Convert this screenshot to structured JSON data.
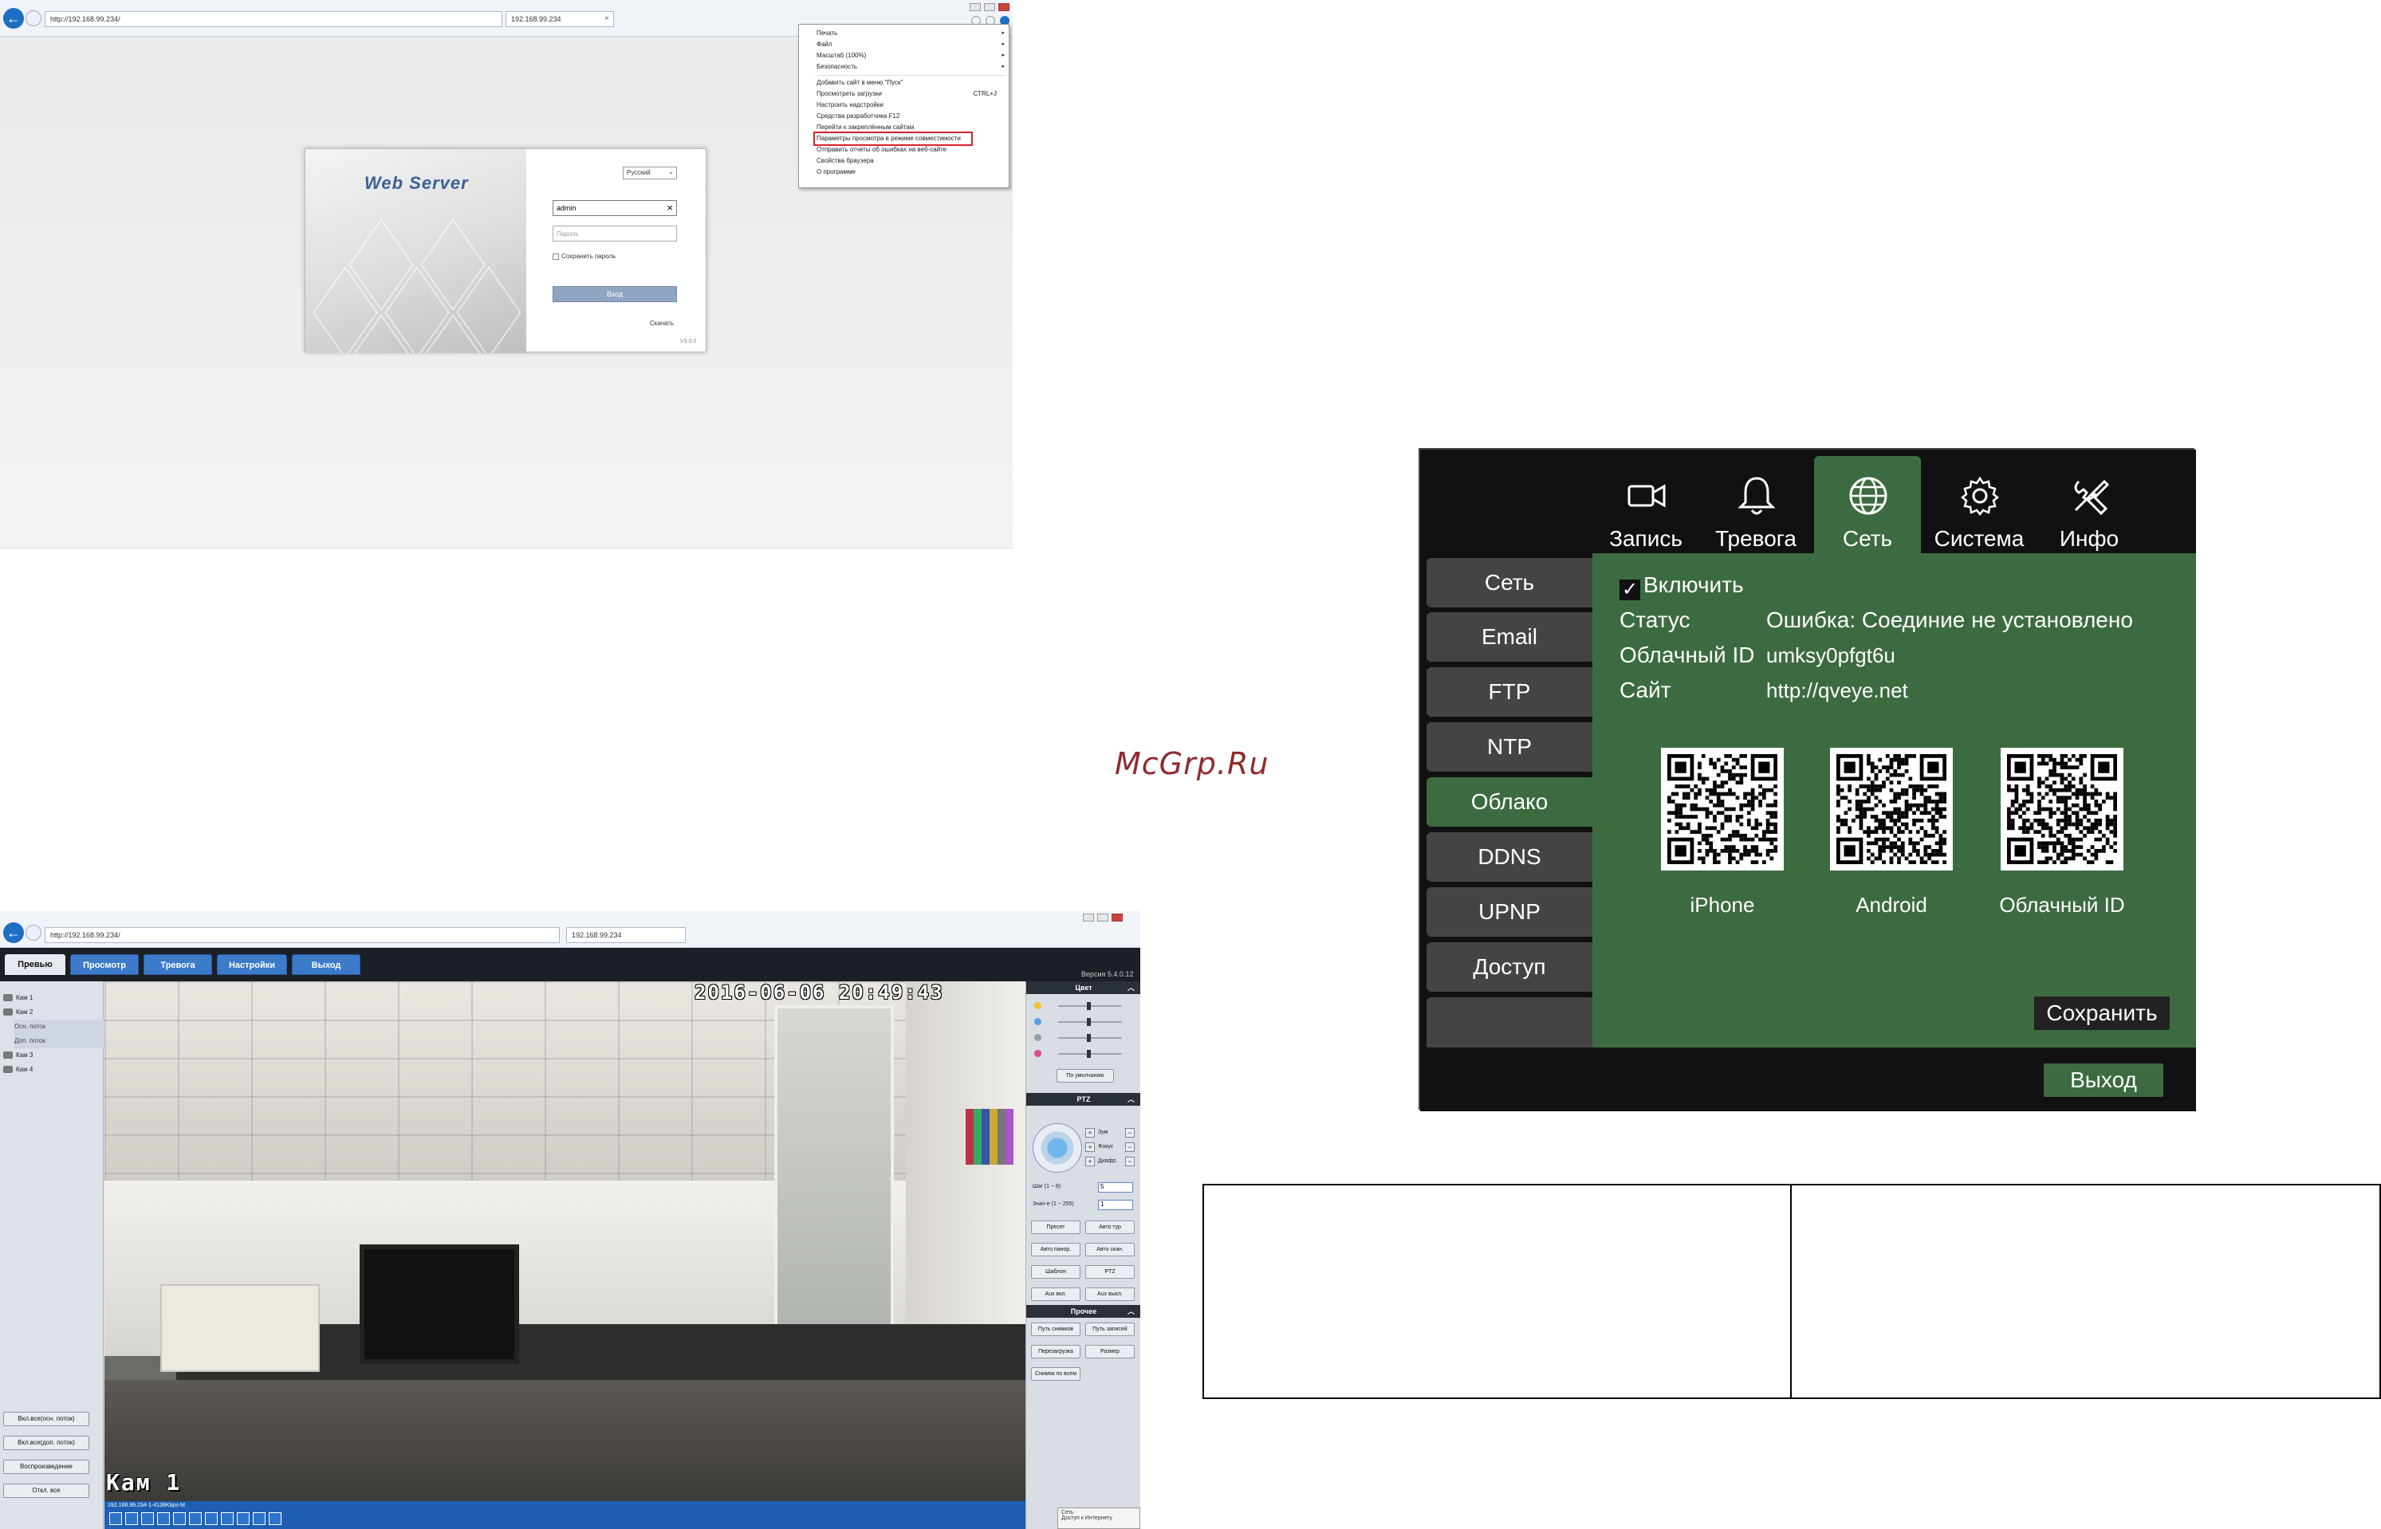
{
  "browser1": {
    "url": "http://192.168.99.234/",
    "tab": "192.168.99.234",
    "menu": [
      {
        "label": "Печать",
        "arrow": "▸"
      },
      {
        "label": "Файл",
        "arrow": "▸"
      },
      {
        "label": "Масштаб (100%)",
        "arrow": "▸"
      },
      {
        "label": "Безопасность",
        "arrow": "▸"
      },
      {
        "label": "Добавить сайт в меню \"Пуск\"",
        "arrow": ""
      },
      {
        "label": "Просмотреть загрузки",
        "shortcut": "CTRL+J"
      },
      {
        "label": "Настроить надстройки",
        "arrow": ""
      },
      {
        "label": "Средства разработчика F12",
        "arrow": ""
      },
      {
        "label": "Перейти к закреплённым сайтам",
        "arrow": ""
      },
      {
        "label": "Параметры просмотра в режиме совместимости",
        "arrow": ""
      },
      {
        "label": "Отправить отчеты об ошибках на веб-сайте",
        "arrow": ""
      },
      {
        "label": "Свойства браузера",
        "arrow": ""
      },
      {
        "label": "О программе",
        "arrow": ""
      }
    ]
  },
  "login": {
    "title": "Web Server",
    "language": "Русский",
    "username": "admin",
    "password_placeholder": "Пароль",
    "remember": "Сохранить пароль",
    "login_button": "Вход",
    "download": "Скачать",
    "version": "V3.0.0"
  },
  "browser2": {
    "url": "http://192.168.99.234/",
    "tab": "192.168.99.234"
  },
  "liveview": {
    "nav": [
      "Превью",
      "Просмотр",
      "Тревога",
      "Настройки",
      "Выход"
    ],
    "version": "Версия 5.4.0.12",
    "cameras": [
      {
        "label": "Кам 1",
        "sub": false,
        "selected": false
      },
      {
        "label": "Кам 2",
        "sub": false,
        "selected": false
      },
      {
        "label": "Осн. поток",
        "sub": true,
        "selected": true
      },
      {
        "label": "Доп. поток",
        "sub": true,
        "selected": true
      },
      {
        "label": "Кам 3",
        "sub": false,
        "selected": false
      },
      {
        "label": "Кам 4",
        "sub": false,
        "selected": false
      }
    ],
    "side_buttons": [
      "Вкл.все(осн. поток)",
      "Вкл.все(доп. поток)",
      "Воспроизведение",
      "Откл. все"
    ],
    "osd_time": "2016-06-06 20:49:43",
    "osd_cam": "Кам 1",
    "status_text": "192.168.99.234-1-4138Kbps-M",
    "color_panel": {
      "header": "Цвет",
      "dots": [
        "#f0c030",
        "#5aa0e0",
        "#9aa0a8",
        "#d84c8c"
      ],
      "default_btn": "По умолчанию"
    },
    "ptz_panel": {
      "header": "PTZ",
      "labels": [
        "Зум",
        "Фокус",
        "Диафр."
      ],
      "step_label": "Шаг (1 ~ 8)",
      "step_value": "5",
      "value_label": "Знач-е (1 ~ 255)",
      "value_value": "1",
      "buttons": [
        "Пресет",
        "Авто тур",
        "Авто панор.",
        "Авто скан.",
        "Шаблон",
        "PTZ",
        "Aux вкл.",
        "Aux выкл."
      ]
    },
    "other_panel": {
      "header": "Прочее",
      "buttons": [
        "Путь снимков",
        "Путь записей",
        "Перезагрузка",
        "Размер",
        "Снимок по всем"
      ]
    },
    "tray": [
      "Сеть",
      "Доступ к Интернету"
    ]
  },
  "watermark": "McGrp.Ru",
  "dvr": {
    "tabs": [
      {
        "label": "Запись",
        "icon": "camera-icon",
        "active": false
      },
      {
        "label": "Тревога",
        "icon": "bell-icon",
        "active": false
      },
      {
        "label": "Сеть",
        "icon": "globe-icon",
        "active": true
      },
      {
        "label": "Система",
        "icon": "gear-icon",
        "active": false
      },
      {
        "label": "Инфо",
        "icon": "tools-icon",
        "active": false
      }
    ],
    "side": [
      {
        "label": "Сеть",
        "active": false
      },
      {
        "label": "Email",
        "active": false
      },
      {
        "label": "FTP",
        "active": false
      },
      {
        "label": "NTP",
        "active": false
      },
      {
        "label": "Облако",
        "active": true
      },
      {
        "label": "DDNS",
        "active": false
      },
      {
        "label": "UPNP",
        "active": false
      },
      {
        "label": "Доступ",
        "active": false
      }
    ],
    "enable_label": "Включить",
    "enable_check": "✓",
    "fields": [
      {
        "label": "Статус",
        "value": "Ошибка: Соединие не установлено"
      },
      {
        "label": "Облачный ID",
        "value": "umksy0pfgt6u"
      },
      {
        "label": "Сайт",
        "value": "http://qveye.net"
      }
    ],
    "qrs": [
      "iPhone",
      "Android",
      "Облачный ID"
    ],
    "save": "Сохранить",
    "exit": "Выход"
  }
}
